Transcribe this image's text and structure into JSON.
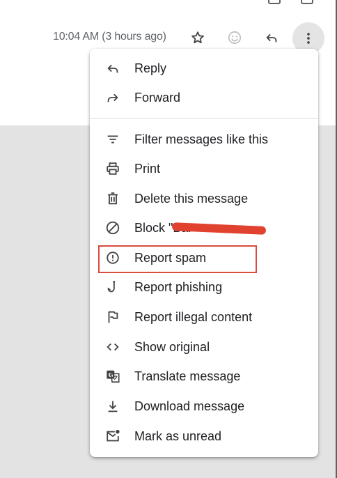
{
  "header": {
    "timestamp": "10:04 AM (3 hours ago)",
    "icons": [
      "star-icon",
      "emoji-icon",
      "reply-icon",
      "more-vert-icon"
    ]
  },
  "menu": {
    "items": [
      {
        "label": "Reply",
        "icon": "reply-icon"
      },
      {
        "label": "Forward",
        "icon": "forward-icon"
      },
      {
        "label": "Filter messages like this",
        "icon": "filter-icon"
      },
      {
        "label": "Print",
        "icon": "print-icon"
      },
      {
        "label": "Delete this message",
        "icon": "trash-icon"
      },
      {
        "label": "Block \"Bar",
        "icon": "block-icon"
      },
      {
        "label": "Report spam",
        "icon": "report-spam-icon"
      },
      {
        "label": "Report phishing",
        "icon": "phishing-hook-icon"
      },
      {
        "label": "Report illegal content",
        "icon": "flag-icon"
      },
      {
        "label": "Show original",
        "icon": "code-icon"
      },
      {
        "label": "Translate message",
        "icon": "translate-icon"
      },
      {
        "label": "Download message",
        "icon": "download-icon"
      },
      {
        "label": "Mark as unread",
        "icon": "mark-unread-icon"
      }
    ]
  },
  "colors": {
    "annotation_box": "#d94b3d",
    "redaction": "#e1412f",
    "icon_gray": "#5f6368",
    "background_gray": "#e3e3e3"
  }
}
